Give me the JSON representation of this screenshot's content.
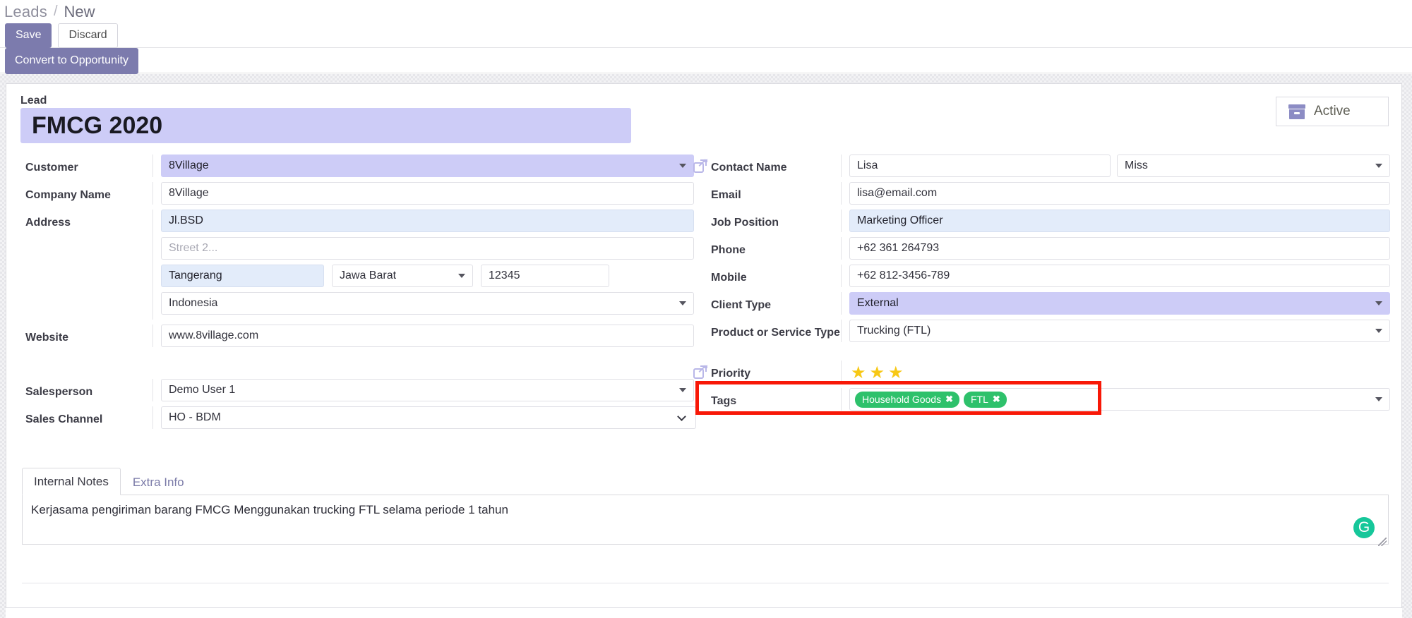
{
  "breadcrumb": {
    "root": "Leads",
    "separator": "/",
    "current": "New"
  },
  "toolbar": {
    "save_label": "Save",
    "discard_label": "Discard"
  },
  "statusbar": {
    "convert_label": "Convert to Opportunity"
  },
  "record": {
    "lead_label": "Lead",
    "lead_title": "FMCG 2020",
    "active_badge": {
      "label": "Active",
      "icon": "archive-box-icon"
    }
  },
  "left_column": {
    "customer": {
      "label": "Customer",
      "value": "8Village",
      "highlight": "#cdccf7"
    },
    "company_name": {
      "label": "Company Name",
      "value": "8Village"
    },
    "address": {
      "label": "Address",
      "street1": "Jl.BSD",
      "street2_placeholder": "Street 2...",
      "street2": "",
      "city": "Tangerang",
      "state": "Jawa Barat",
      "zip": "12345",
      "country": "Indonesia"
    },
    "website": {
      "label": "Website",
      "value": "www.8village.com"
    },
    "salesperson": {
      "label": "Salesperson",
      "value": "Demo User 1"
    },
    "sales_channel": {
      "label": "Sales Channel",
      "value": "HO - BDM"
    }
  },
  "right_column": {
    "contact_name": {
      "label": "Contact Name",
      "value": "Lisa",
      "title": "Miss",
      "icon": "external-link-icon"
    },
    "email": {
      "label": "Email",
      "value": "lisa@email.com"
    },
    "job_position": {
      "label": "Job Position",
      "value": "Marketing Officer",
      "highlight": "#e3ecfa"
    },
    "phone": {
      "label": "Phone",
      "value": "+62 361 264793"
    },
    "mobile": {
      "label": "Mobile",
      "value": "+62 812-3456-789"
    },
    "client_type": {
      "label": "Client Type",
      "value": "External",
      "highlight": "#cdccf7"
    },
    "product_service_type": {
      "label": "Product or Service Type",
      "value": "Trucking (FTL)"
    },
    "priority": {
      "label": "Priority",
      "stars_filled": 3,
      "star_color": "#f7c815",
      "icon": "external-link-icon"
    },
    "tags": {
      "label": "Tags",
      "items": [
        "Household Goods",
        "FTL"
      ],
      "color": "#2ec16b",
      "remove_icon": "close-icon"
    }
  },
  "notes": {
    "tabs": [
      {
        "label": "Internal Notes",
        "active": true
      },
      {
        "label": "Extra Info",
        "active": false
      }
    ],
    "body": "Kerjasama pengiriman barang FMCG Menggunakan trucking FTL selama periode 1 tahun",
    "grammarly_icon": "G"
  },
  "annotation": {
    "color": "#f81807",
    "target": "priority-field"
  },
  "colors": {
    "primary": "#7c7bad",
    "highlight_purple": "#cdccf7",
    "highlight_blue": "#e3ecfa",
    "tag_green": "#2ec16b",
    "star_gold": "#f7c815",
    "annotation_red": "#f81807"
  }
}
